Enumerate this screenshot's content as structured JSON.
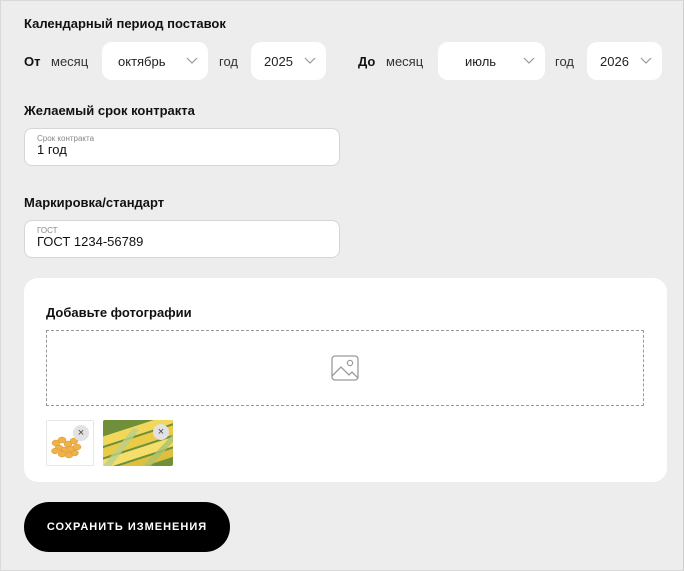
{
  "period": {
    "heading": "Календарный период поставок",
    "from_label": "От",
    "to_label": "До",
    "month_label": "месяц",
    "year_label": "год",
    "from_month": "октябрь",
    "from_year": "2025",
    "to_month": "июль",
    "to_year": "2026"
  },
  "contract": {
    "heading": "Желаемый срок контракта",
    "placeholder": "Срок контракта",
    "value": "1 год"
  },
  "marking": {
    "heading": "Маркировка/стандарт",
    "placeholder": "ГОСТ",
    "value": "ГОСТ 1234-56789"
  },
  "photos": {
    "heading": "Добавьте фотографии",
    "remove_symbol": "×",
    "items": [
      {
        "name": "peanuts-photo"
      },
      {
        "name": "corn-photo"
      }
    ]
  },
  "save_button": "СОХРАНИТЬ ИЗМЕНЕНИЯ",
  "colors": {
    "background": "#ededed",
    "button": "#000000",
    "card": "#ffffff"
  }
}
